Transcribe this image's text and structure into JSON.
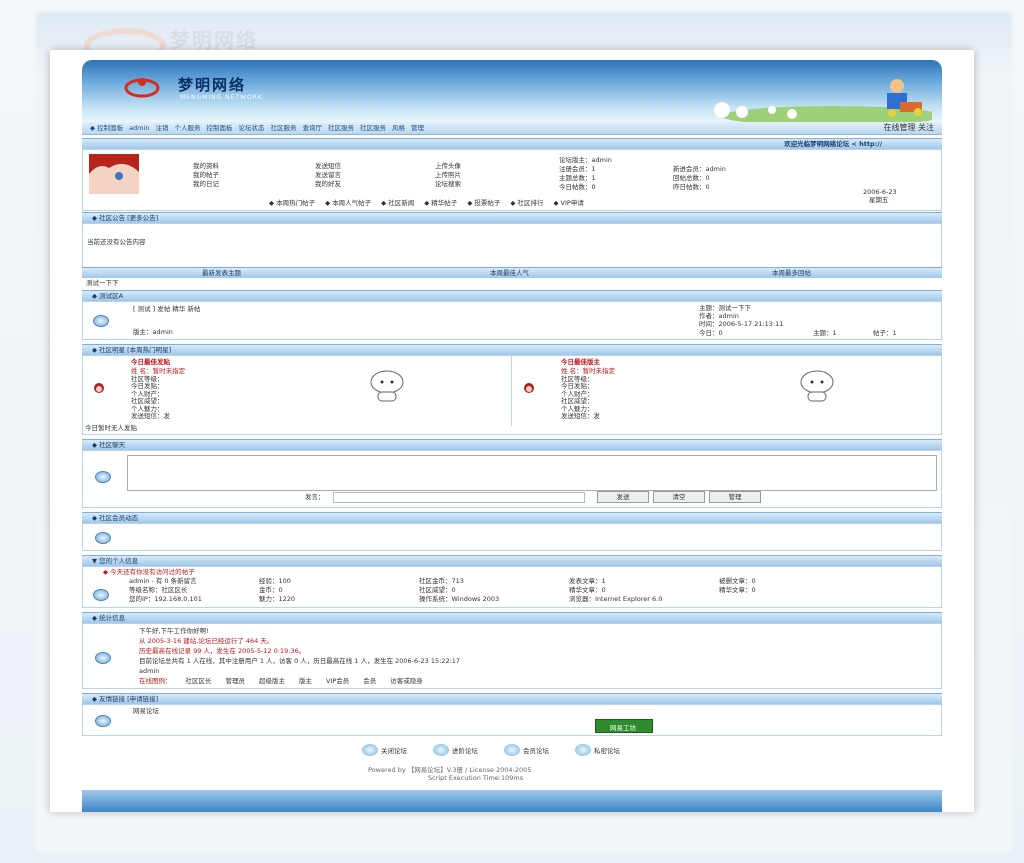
{
  "site": {
    "title": "梦明网络",
    "subtitle": "MENGMING NETWORK"
  },
  "nav": {
    "left": [
      "◆ 控制面板",
      "admin",
      "注销",
      "个人服务",
      "控制面板",
      "论坛状态",
      "社区服务",
      "查询厅",
      "社区服务",
      "社区服务",
      "风格",
      "管理"
    ],
    "right": "在线管理  关注"
  },
  "welcome": "欢迎光临梦明网络论坛  <  http://",
  "user": {
    "links_col1": [
      "我的资料",
      "我的帖子",
      "我的日记"
    ],
    "links_col2": [
      "发送短信",
      "发送留言",
      "我的好友"
    ],
    "links_col3": [
      "上传头像",
      "上传照片",
      "论坛搜索"
    ],
    "stats": [
      "论坛版主：admin",
      "注册会员：1",
      "主题总数：1",
      "今日帖数：0"
    ],
    "stats2": [
      "新进会员：admin",
      "回帖总数：0",
      "昨日帖数：0"
    ],
    "date": "2006-6-23",
    "weekday": "星期五",
    "quicklinks": [
      "◆ 本周热门帖子",
      "◆ 本周人气帖子",
      "◆ 社区新闻",
      "◆ 精华帖子",
      "◆ 投票帖子",
      "◆ 社区排行",
      "◆ VIP申请"
    ]
  },
  "announce": {
    "head": "◆ 社区公告    [更多公告]",
    "body": "当前还没有公告内容"
  },
  "tabs": [
    "最新发表主题",
    "本周最佳人气",
    "本周最多回帖"
  ],
  "test_item": "测试一下下",
  "forum": {
    "head": "◆ 测试区A",
    "links": "[ 测试 ] 发帖  精华  新帖",
    "mod": "版主：admin",
    "topic": "主题：测试一下下",
    "author": "作者：admin",
    "time": "时间：2006-5-17 21:13:11",
    "counts": [
      "今日：0",
      "主题：1",
      "帖子：1"
    ]
  },
  "star": {
    "head": "◆ 社区明星  [本周热门明星]",
    "left_title": "今日最佳发贴",
    "right_title": "今日最佳版主",
    "rows": [
      "姓    名：暂时未指定",
      "社区等级：",
      "今日发贴：",
      "个人财产：",
      "社区威望：",
      "个人魅力：",
      "发送短信：发"
    ],
    "note": "今日暂时无人发贴"
  },
  "chat": {
    "head": "◆ 社区聊天",
    "say_label": "发言：",
    "send": "发送",
    "clear": "清空",
    "manage": "管理"
  },
  "online_head": "◆ 社区会员动态",
  "personal": {
    "head": "▼ 您的个人信息",
    "warn": "◆ 今天还有你没有访问过的帖子",
    "rows": [
      [
        "admin - 有 0 条新留言",
        "经验：100",
        "社区金币：713",
        "发表文章：1",
        "被删文章：0"
      ],
      [
        "等级名称：社区区长",
        "金币：0",
        "社区威望：0",
        "精华文章：0",
        "精华文章：0"
      ],
      [
        "您的IP：192.168.0.101",
        "魅力：1220",
        "操作系统：Windows 2003",
        "浏览器：Internet Explorer 6.0",
        ""
      ]
    ]
  },
  "stats": {
    "head": "◆ 统计信息",
    "lines": [
      "下午好,下午工作你好啊!",
      "从 2005-3-16 建站,论坛已经运行了 464 天。",
      "历史最高在线记录 99 人，发生在 2005-5-12 0:19:36。",
      "目前论坛总共有 1 人在线，其中注册用户 1 人，访客 0 人，历日最高在线 1 人，发生在 2006-6-23 15:22:17",
      "admin"
    ],
    "legend": [
      "在线图例：",
      "社区区长",
      "管理员",
      "超级版主",
      "版主",
      "VIP会员",
      "会员",
      "访客或隐身"
    ]
  },
  "links": {
    "head": "◆ 友情链接    [申请链接]",
    "name": "网易论坛",
    "badge": "网易工坊"
  },
  "footer": {
    "icons": [
      "关闭论坛",
      "进阶论坛",
      "会员论坛",
      "私密论坛"
    ],
    "powered": "Powered by  【网易论坛】V.3册 / License 2004-2005",
    "time": "Script Execution Time:109ms"
  }
}
